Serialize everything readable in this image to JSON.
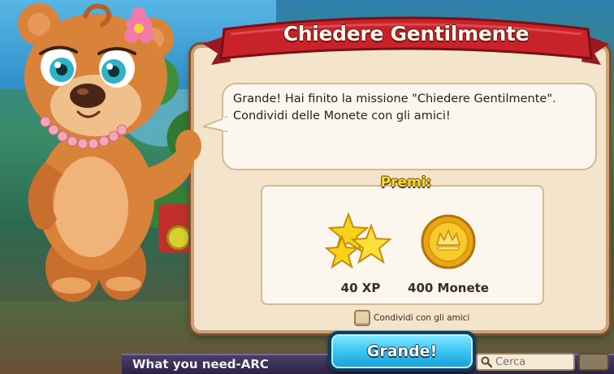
{
  "dialog": {
    "title": "Chiedere Gentilmente",
    "message": "Grande! Hai finito la missione \"Chiedere Gentilmente\". Condividi delle Monete con gli amici!",
    "rewards_title": "Premi:",
    "rewards": [
      {
        "icon": "stars-icon",
        "label": "40 XP"
      },
      {
        "icon": "gold-coin-icon",
        "label": "400 Monete"
      }
    ],
    "share_checkbox": {
      "label": "Condividi con gli amici",
      "checked": false
    },
    "confirm_button": "Grande!"
  },
  "footer": {
    "banner_text": "What you need-ARC",
    "search_placeholder": "Cerca"
  },
  "colors": {
    "ribbon_red": "#c8222b",
    "panel_bg": "#f4e4cc",
    "button_blue": "#3cc4f2",
    "rewards_title_yellow": "#ffde1f"
  }
}
